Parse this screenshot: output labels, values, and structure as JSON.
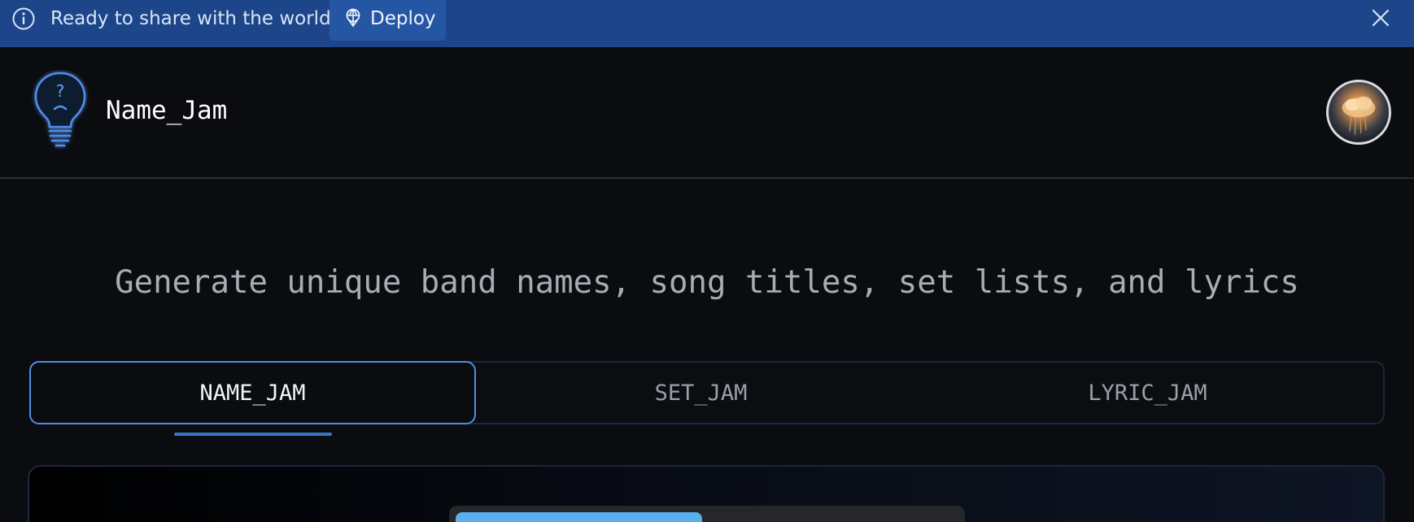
{
  "banner": {
    "message": "Ready to share with the world?",
    "deploy_label": "Deploy",
    "icons": {
      "info": "info-icon",
      "deploy": "deploy-icon",
      "close": "close-icon"
    }
  },
  "header": {
    "app_title": "Name_Jam",
    "logo_icon": "lightbulb-question-icon",
    "avatar_alt": "user-avatar"
  },
  "main": {
    "subtitle": "Generate unique band names, song titles, set lists, and lyrics",
    "tabs": [
      {
        "label": "NAME_JAM",
        "active": true
      },
      {
        "label": "SET_JAM",
        "active": false
      },
      {
        "label": "LYRIC_JAM",
        "active": false
      }
    ],
    "progress_fraction": 0.49
  },
  "colors": {
    "banner_bg": "#1c4689",
    "deploy_bg": "#2556a3",
    "accent": "#4f8ee6",
    "progress_fill": "#5ab0ef",
    "page_bg": "#0b0c0f"
  }
}
